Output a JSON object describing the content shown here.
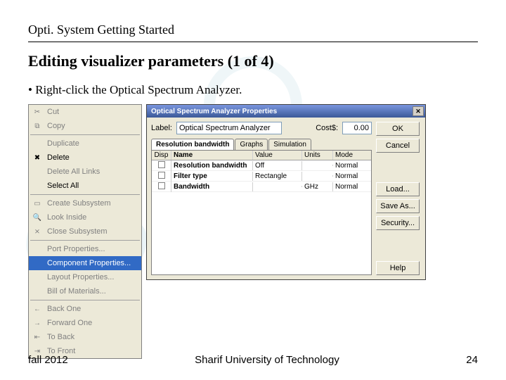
{
  "doc": {
    "title": "Opti. System Getting Started",
    "heading": "Editing visualizer parameters (1 of 4)",
    "bullet": "Right-click the Optical Spectrum Analyzer."
  },
  "context_menu": {
    "items": [
      {
        "icon": "✂",
        "label": "Cut",
        "disabled": true
      },
      {
        "icon": "⧉",
        "label": "Copy",
        "disabled": true
      },
      {
        "sep": true
      },
      {
        "icon": "",
        "label": "Duplicate",
        "disabled": true
      },
      {
        "icon": "✖",
        "label": "Delete",
        "disabled": false
      },
      {
        "icon": "",
        "label": "Delete All Links",
        "disabled": true
      },
      {
        "icon": "",
        "label": "Select All",
        "disabled": false
      },
      {
        "sep": true
      },
      {
        "icon": "▭",
        "label": "Create Subsystem",
        "disabled": true
      },
      {
        "icon": "🔍",
        "label": "Look Inside",
        "disabled": true
      },
      {
        "icon": "⨯",
        "label": "Close Subsystem",
        "disabled": true
      },
      {
        "sep": true
      },
      {
        "icon": "",
        "label": "Port Properties...",
        "disabled": true
      },
      {
        "icon": "",
        "label": "Component Properties...",
        "disabled": false,
        "selected": true
      },
      {
        "icon": "",
        "label": "Layout Properties...",
        "disabled": true
      },
      {
        "icon": "",
        "label": "Bill of Materials...",
        "disabled": true
      },
      {
        "sep": true
      },
      {
        "icon": "←",
        "label": "Back One",
        "disabled": true
      },
      {
        "icon": "→",
        "label": "Forward One",
        "disabled": true
      },
      {
        "icon": "⇤",
        "label": "To Back",
        "disabled": true
      },
      {
        "icon": "⇥",
        "label": "To Front",
        "disabled": true
      }
    ]
  },
  "dialog": {
    "title": "Optical Spectrum Analyzer Properties",
    "label_field_label": "Label:",
    "label_value": "Optical Spectrum Analyzer",
    "cost_label": "Cost$:",
    "cost_value": "0.00",
    "buttons": {
      "ok": "OK",
      "cancel": "Cancel",
      "load": "Load...",
      "save_as": "Save As...",
      "security": "Security...",
      "help": "Help"
    },
    "tabs": [
      "Resolution bandwidth",
      "Graphs",
      "Simulation"
    ],
    "active_tab": 0,
    "grid": {
      "headers": {
        "disp": "Disp",
        "name": "Name",
        "value": "Value",
        "units": "Units",
        "mode": "Mode"
      },
      "rows": [
        {
          "name": "Resolution bandwidth",
          "value": "Off",
          "units": "",
          "mode": "Normal"
        },
        {
          "name": "Filter type",
          "value": "Rectangle",
          "units": "",
          "mode": "Normal"
        },
        {
          "name": "Bandwidth",
          "value": "",
          "units": "GHz",
          "mode": "Normal"
        }
      ]
    }
  },
  "footer": {
    "left": "fall 2012",
    "center": "Sharif University of Technology",
    "right": "24"
  }
}
